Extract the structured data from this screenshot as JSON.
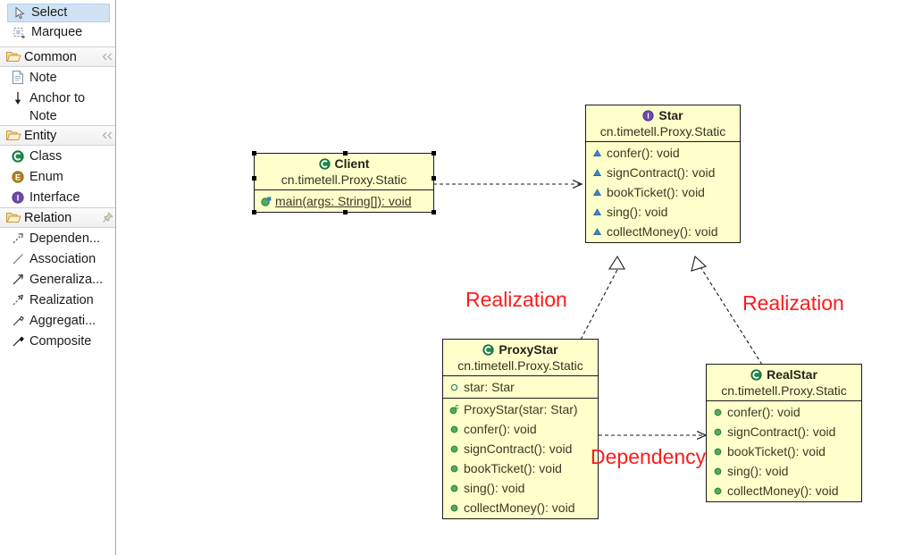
{
  "palette": {
    "tools": [
      {
        "label": "Select",
        "icon": "cursor-arrow-icon",
        "selected": true
      },
      {
        "label": "Marquee",
        "icon": "marquee-select-icon",
        "selected": false
      }
    ],
    "sections": [
      {
        "title": "Common",
        "icon": "open-folder-icon",
        "action_icon": "collapse-chevrons-icon",
        "items": [
          {
            "label": "Note",
            "icon": "note-icon"
          },
          {
            "label": "Anchor to Note",
            "icon": "anchor-arrow-icon"
          }
        ]
      },
      {
        "title": "Entity",
        "icon": "open-folder-icon",
        "action_icon": "collapse-chevrons-icon",
        "items": [
          {
            "label": "Class",
            "icon": "class-c-icon"
          },
          {
            "label": "Enum",
            "icon": "enum-e-icon"
          },
          {
            "label": "Interface",
            "icon": "interface-i-icon"
          }
        ]
      },
      {
        "title": "Relation",
        "icon": "open-folder-icon",
        "action_icon": "pin-icon",
        "items": [
          {
            "label": "Dependen...",
            "icon": "dependency-arrow-icon"
          },
          {
            "label": "Association",
            "icon": "association-line-icon"
          },
          {
            "label": "Generaliza...",
            "icon": "generalization-arrow-icon"
          },
          {
            "label": "Realization",
            "icon": "realization-arrow-icon"
          },
          {
            "label": "Aggregati...",
            "icon": "aggregation-diamond-icon"
          },
          {
            "label": "Composite",
            "icon": "composition-diamond-icon"
          }
        ]
      }
    ]
  },
  "diagram": {
    "classes": [
      {
        "id": "client",
        "name": "Client",
        "stereotype_icon": "class-c-icon",
        "package": "cn.timetell.Proxy.Static",
        "selected": true,
        "compartments": [
          {
            "members": [
              {
                "text": "main(args: String[]): void",
                "icon": "public-static-method-icon",
                "static": true
              }
            ]
          }
        ]
      },
      {
        "id": "star",
        "name": "Star",
        "stereotype_icon": "interface-i-icon",
        "package": "cn.timetell.Proxy.Static",
        "selected": false,
        "compartments": [
          {
            "members": [
              {
                "text": "confer(): void",
                "icon": "interface-method-icon",
                "static": false
              },
              {
                "text": "signContract(): void",
                "icon": "interface-method-icon",
                "static": false
              },
              {
                "text": "bookTicket(): void",
                "icon": "interface-method-icon",
                "static": false
              },
              {
                "text": "sing(): void",
                "icon": "interface-method-icon",
                "static": false
              },
              {
                "text": "collectMoney(): void",
                "icon": "interface-method-icon",
                "static": false
              }
            ]
          }
        ]
      },
      {
        "id": "proxystar",
        "name": "ProxyStar",
        "stereotype_icon": "class-c-icon",
        "package": "cn.timetell.Proxy.Static",
        "selected": false,
        "compartments": [
          {
            "members": [
              {
                "text": "star: Star",
                "icon": "private-field-icon",
                "static": false
              }
            ]
          },
          {
            "members": [
              {
                "text": "ProxyStar(star: Star)",
                "icon": "constructor-icon",
                "static": false
              },
              {
                "text": "confer(): void",
                "icon": "public-method-icon",
                "static": false
              },
              {
                "text": "signContract(): void",
                "icon": "public-method-icon",
                "static": false
              },
              {
                "text": "bookTicket(): void",
                "icon": "public-method-icon",
                "static": false
              },
              {
                "text": "sing(): void",
                "icon": "public-method-icon",
                "static": false
              },
              {
                "text": "collectMoney(): void",
                "icon": "public-method-icon",
                "static": false
              }
            ]
          }
        ]
      },
      {
        "id": "realstar",
        "name": "RealStar",
        "stereotype_icon": "class-c-icon",
        "package": "cn.timetell.Proxy.Static",
        "selected": false,
        "compartments": [
          {
            "members": [
              {
                "text": "confer(): void",
                "icon": "public-method-icon",
                "static": false
              },
              {
                "text": "signContract(): void",
                "icon": "public-method-icon",
                "static": false
              },
              {
                "text": "bookTicket(): void",
                "icon": "public-method-icon",
                "static": false
              },
              {
                "text": "sing(): void",
                "icon": "public-method-icon",
                "static": false
              },
              {
                "text": "collectMoney(): void",
                "icon": "public-method-icon",
                "static": false
              }
            ]
          }
        ]
      }
    ],
    "annotations": [
      {
        "text": "Realization",
        "color": "#ff1a1a"
      },
      {
        "text": "Realization",
        "color": "#ff1a1a"
      },
      {
        "text": "Dependency",
        "color": "#ff1a1a"
      }
    ],
    "relations": [
      {
        "type": "dependency",
        "from": "client",
        "to": "star"
      },
      {
        "type": "realization",
        "from": "proxystar",
        "to": "star"
      },
      {
        "type": "realization",
        "from": "realstar",
        "to": "star"
      },
      {
        "type": "dependency",
        "from": "proxystar",
        "to": "realstar"
      }
    ]
  },
  "colors": {
    "class_fill": "#ffffcc",
    "class_border": "#1a1a1a",
    "annotation_red": "#ff1a1a",
    "selection_blue": "#cfe2f3"
  }
}
